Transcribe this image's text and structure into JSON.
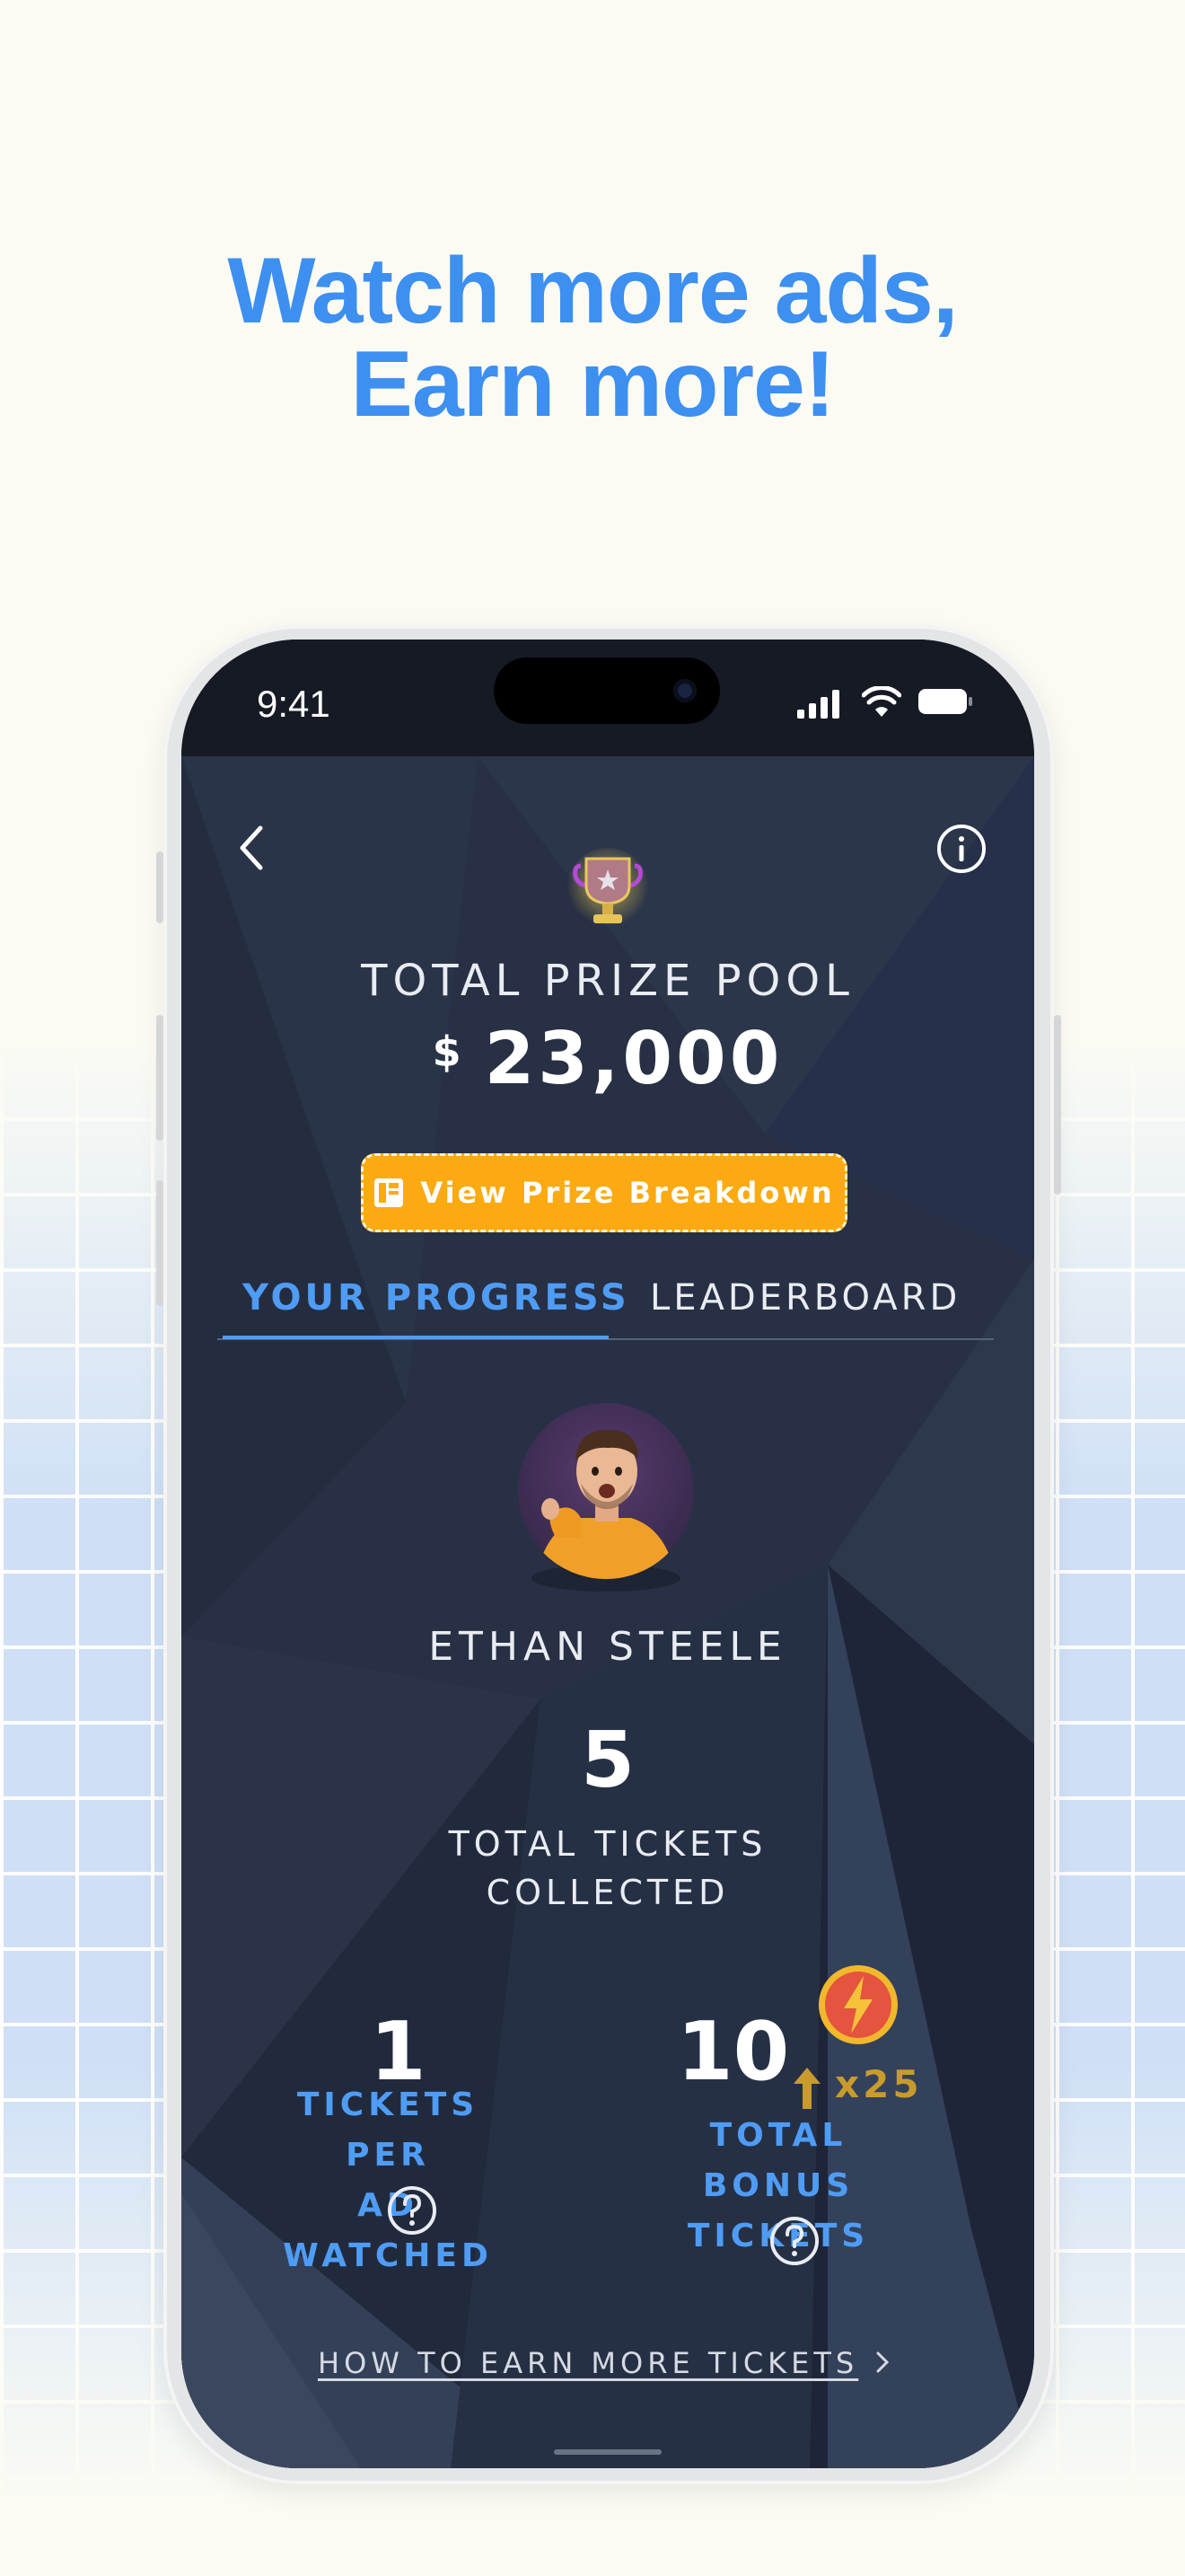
{
  "headline": {
    "line1": "Watch more ads,",
    "line2": "Earn more!"
  },
  "status_bar": {
    "time": "9:41"
  },
  "prize": {
    "label": "TOTAL PRIZE POOL",
    "currency": "$",
    "amount": "23,000",
    "breakdown_button": "View Prize Breakdown"
  },
  "tabs": [
    {
      "label": "YOUR PROGRESS",
      "active": true
    },
    {
      "label": "LEADERBOARD",
      "active": false
    }
  ],
  "user": {
    "name": "ETHAN STEELE"
  },
  "totals": {
    "count": "5",
    "label_line1": "TOTAL TICKETS",
    "label_line2": "COLLECTED"
  },
  "stats": {
    "per_ad": {
      "value": "1",
      "label_line1": "TICKETS PER",
      "label_line2": "AD WATCHED"
    },
    "bonus": {
      "value": "10",
      "label_line1": "TOTAL BONUS",
      "label_line2": "TICKETS",
      "multiplier": "x25"
    }
  },
  "earn_link": "HOW TO EARN MORE TICKETS",
  "colors": {
    "accent": "#4f9cf5",
    "headline": "#3d8ff0",
    "button": "#fbaa12",
    "background": "#273044",
    "multiplier": "#c99b2e"
  },
  "icons": [
    "back-icon",
    "info-icon",
    "trophy-icon",
    "list-icon",
    "help-icon",
    "bolt-icon",
    "arrow-up-icon",
    "chevron-right-icon"
  ]
}
